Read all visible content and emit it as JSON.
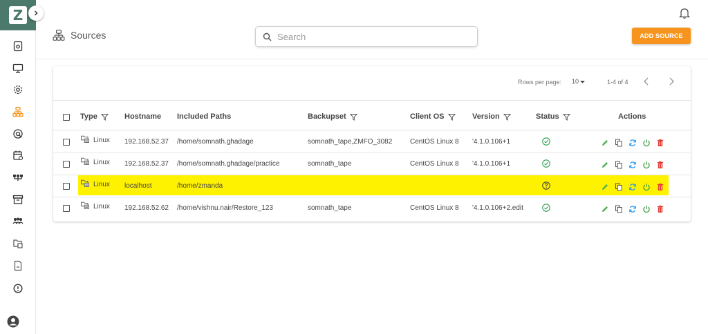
{
  "header": {
    "page_title": "Sources",
    "search_placeholder": "Search",
    "add_source_label": "ADD SOURCE"
  },
  "pagination": {
    "rows_per_page_label": "Rows per page:",
    "rows_per_page_value": "10",
    "range_label": "1-4 of 4"
  },
  "columns": {
    "type": "Type",
    "hostname": "Hostname",
    "included_paths": "Included Paths",
    "backupset": "Backupset",
    "client_os": "Client OS",
    "version": "Version",
    "status": "Status",
    "actions": "Actions"
  },
  "rows": [
    {
      "type": "Linux",
      "hostname": "192.168.52.37",
      "included_paths": "/home/somnath.ghadage",
      "backupset": "somnath_tape,ZMFO_3082",
      "client_os": "CentOS Linux 8",
      "version": "'4.1.0.106+1",
      "status": "ok",
      "highlighted": false
    },
    {
      "type": "Linux",
      "hostname": "192.168.52.37",
      "included_paths": "/home/somnath.ghadage/practice",
      "backupset": "somnath_tape",
      "client_os": "CentOS Linux 8",
      "version": "'4.1.0.106+1",
      "status": "ok",
      "highlighted": false
    },
    {
      "type": "Linux",
      "hostname": "localhost",
      "included_paths": "/home/zmanda",
      "backupset": "",
      "client_os": "",
      "version": "",
      "status": "unknown",
      "highlighted": true
    },
    {
      "type": "Linux",
      "hostname": "192.168.52.62",
      "included_paths": "/home/vishnu.nair/Restore_123",
      "backupset": "somnath_tape",
      "client_os": "CentOS Linux 8",
      "version": "'4.1.0.106+2.edit",
      "status": "ok",
      "highlighted": false
    }
  ],
  "colors": {
    "brand": "#4b7a6c",
    "accent": "#f7941d",
    "status_ok": "#2e9e4f",
    "edit": "#4caf50",
    "refresh": "#2196f3",
    "power": "#43a047",
    "delete": "#e53935",
    "highlight": "#fff200"
  },
  "sidebar_icons": [
    "dashboard-icon",
    "monitor-icon",
    "settings-icon",
    "sources-icon",
    "storage-icon",
    "calendar-icon",
    "network-icon",
    "archive-icon",
    "users-icon",
    "files-icon",
    "document-icon",
    "info-icon"
  ]
}
